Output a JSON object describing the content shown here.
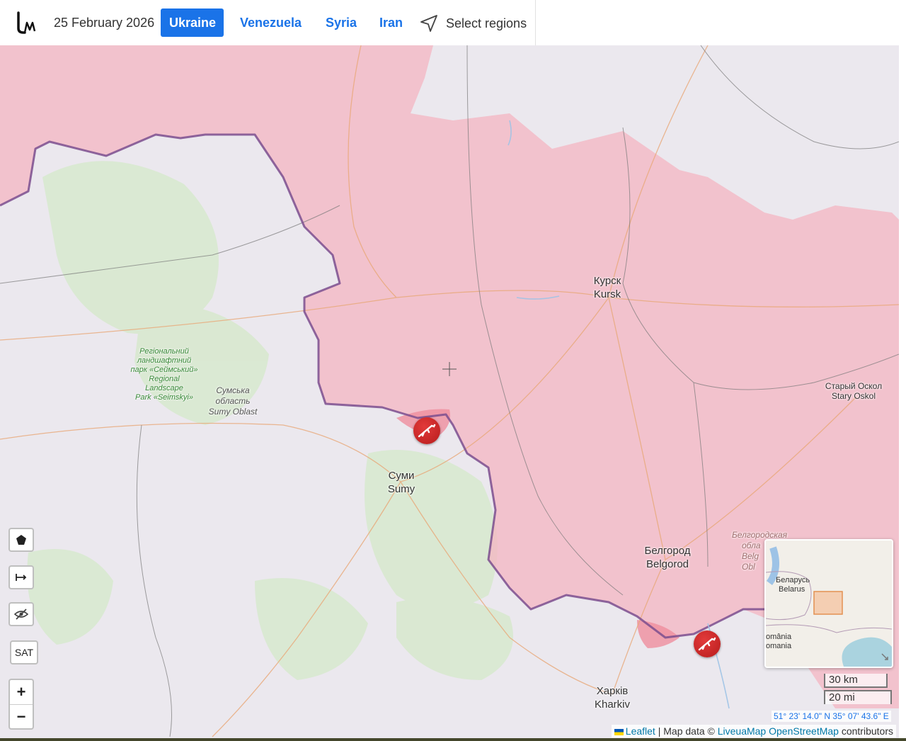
{
  "header": {
    "logo": "logo-icon",
    "date": "25 February 2026",
    "tabs": [
      {
        "label": "Ukraine",
        "active": true
      },
      {
        "label": "Venezuela",
        "active": false
      },
      {
        "label": "Syria",
        "active": false
      },
      {
        "label": "Iran",
        "active": false
      }
    ],
    "select_regions": "Select regions",
    "accent_color": "#1a73e8"
  },
  "map": {
    "places": {
      "kursk_ru": "Курск",
      "kursk_en": "Kursk",
      "sumy_uk": "Суми",
      "sumy_en": "Sumy",
      "belgorod_ru": "Белгород",
      "belgorod_en": "Belgorod",
      "stary_oskol_ru": "Старый Оскол",
      "stary_oskol_en": "Stary Oskol",
      "kharkiv_uk": "Харків",
      "kharkiv_en": "Kharkiv",
      "park_line1": "Регіональний",
      "park_line2": "ландшафтний",
      "park_line3": "парк «Сеймський»",
      "park_line4": "Regional",
      "park_line5": "Landscape",
      "park_line6": "Park «Seimskyi»",
      "sumy_obl_line1": "Сумська",
      "sumy_obl_line2": "область",
      "sumy_obl_line3": "Sumy Oblast",
      "belgorod_obl_line1": "Белгородская",
      "belgorod_obl_line2": "обла",
      "belgorod_obl_line3": "Belg",
      "belgorod_obl_line4": "Obl"
    },
    "occupied_color": "#f4b6c2",
    "front_line_color": "#7b4d8e",
    "markers": [
      "combat-marker",
      "combat-marker"
    ]
  },
  "controls": {
    "draw": "polygon-icon",
    "measure": "measure-icon",
    "hide": "eye-off-icon",
    "sat": "SAT",
    "zoom_in": "+",
    "zoom_out": "−"
  },
  "minimap": {
    "belarus_ru": "Беларусь",
    "belarus_en": "Belarus",
    "romania_1": "omânia",
    "romania_2": "omania"
  },
  "scale": {
    "km": "30 km",
    "mi": "20 mi"
  },
  "coordinates": "51° 23' 14.0\" N 35° 07' 43.6\" E",
  "attribution": {
    "leaflet": "Leaflet",
    "sep1": " | Map data © ",
    "liveuamap": "LiveuaMap",
    "osm": "OpenStreetMap",
    "contributors": " contributors"
  }
}
